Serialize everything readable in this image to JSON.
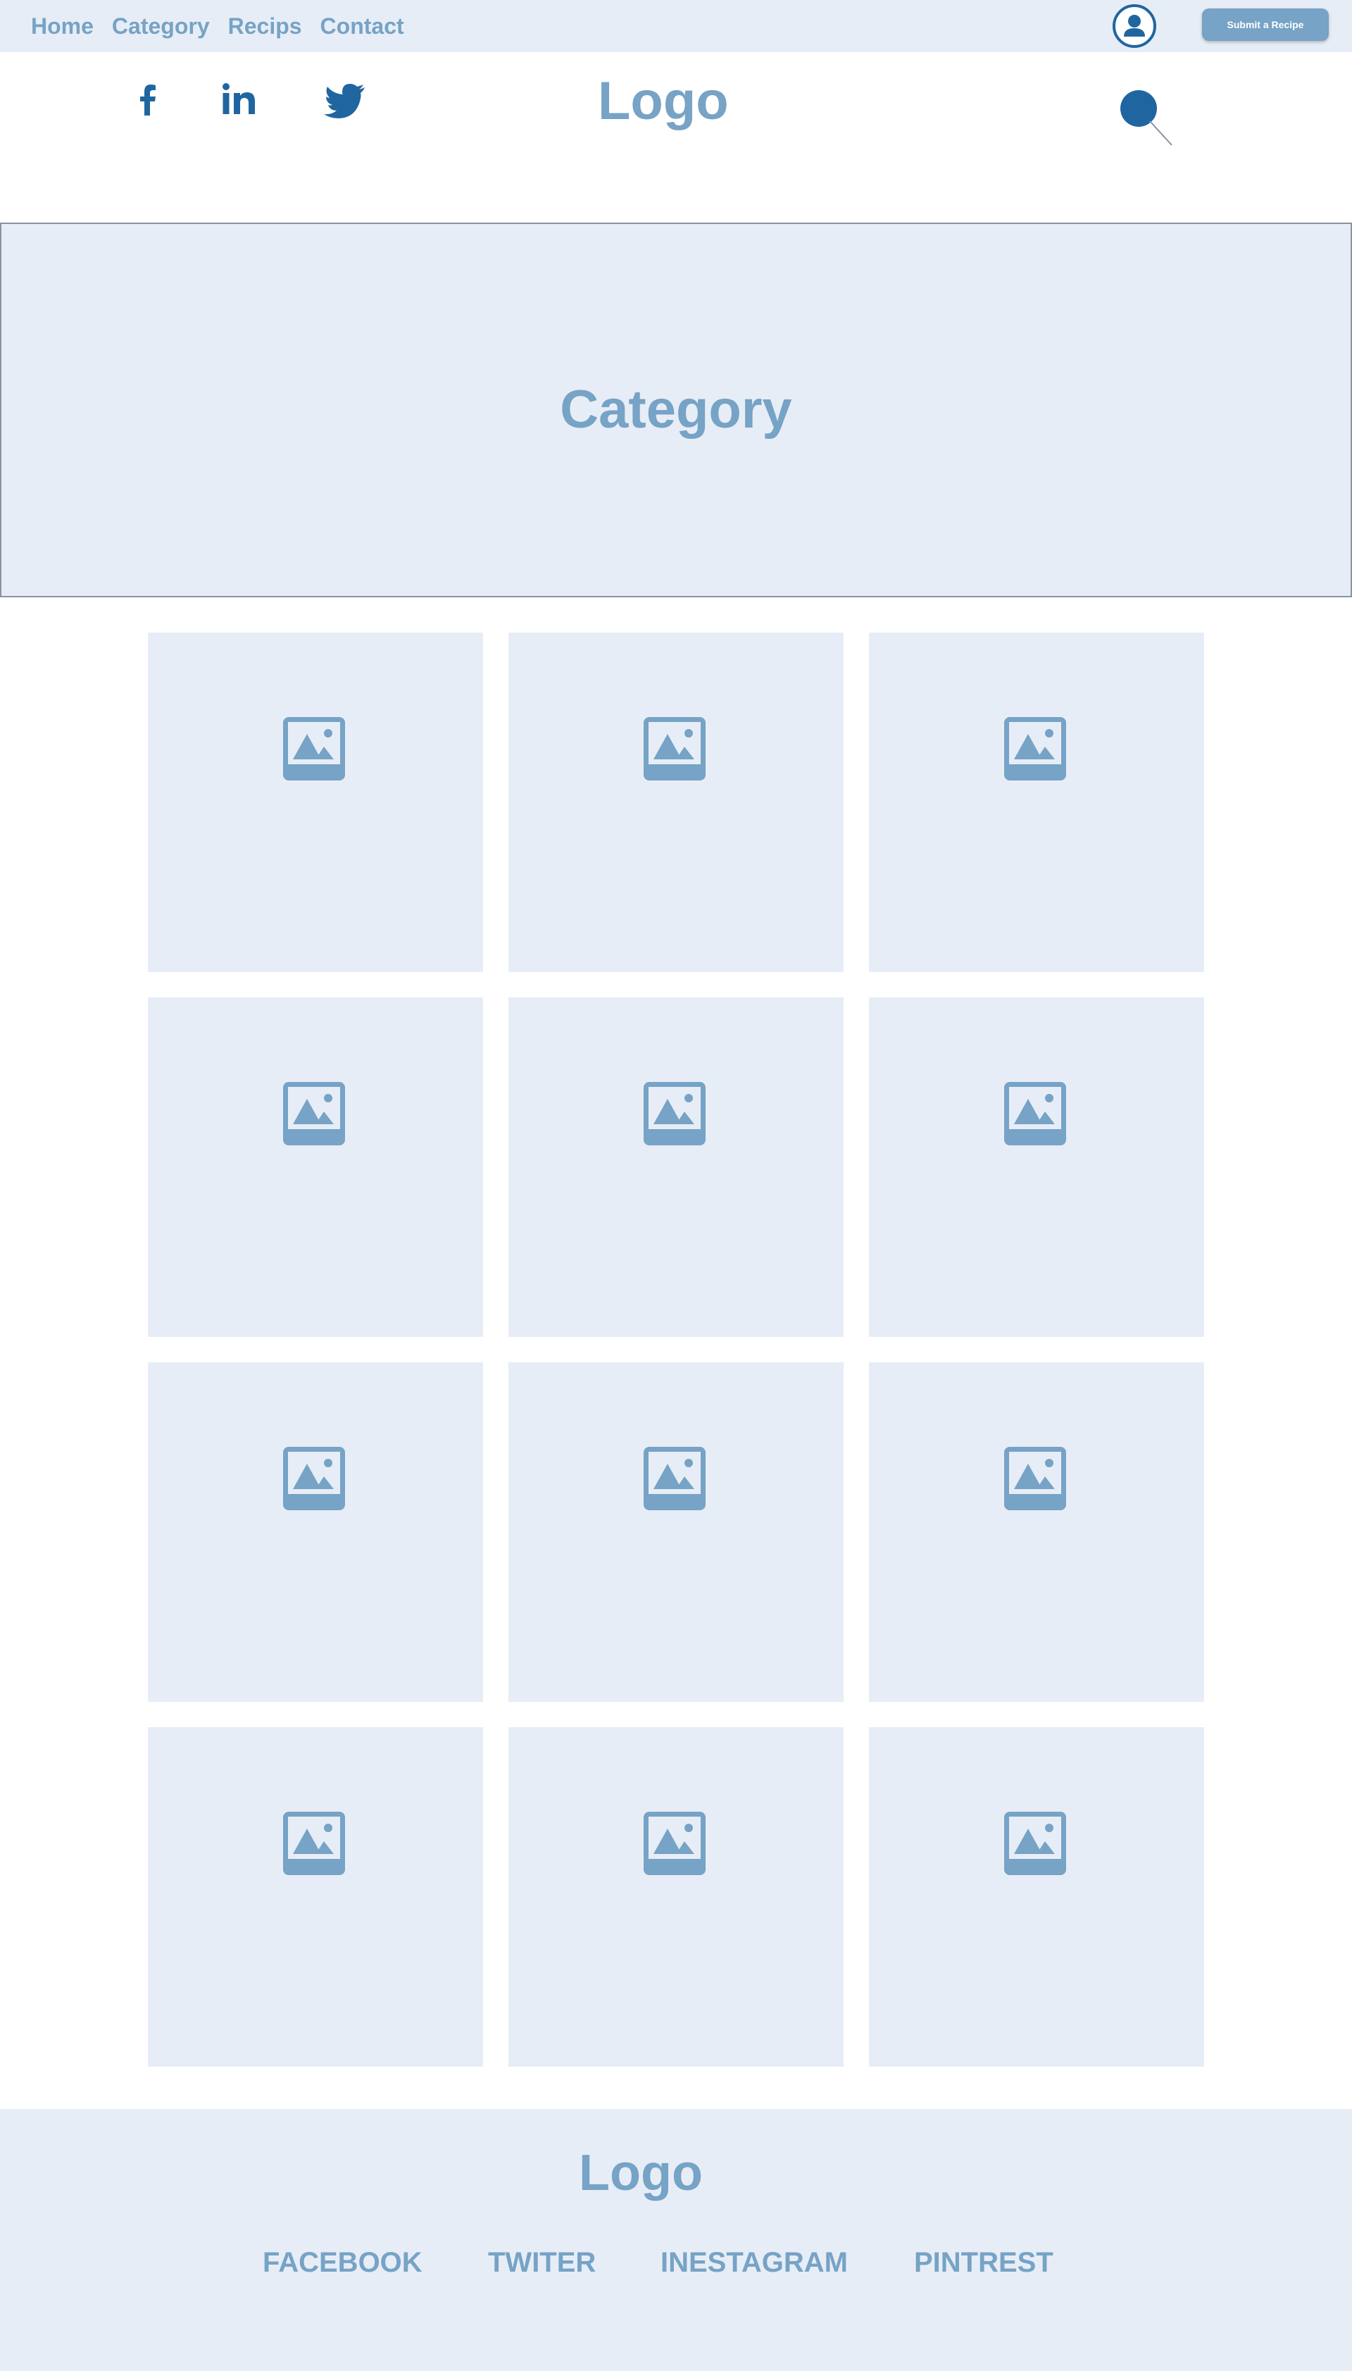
{
  "topbar": {
    "nav": [
      "Home",
      "Category",
      "Recips",
      "Contact"
    ],
    "submit_label": "Submit a Recipe"
  },
  "header": {
    "social_icons": [
      "facebook-icon",
      "linkedin-icon",
      "twitter-icon"
    ],
    "logo": "Logo"
  },
  "hero": {
    "title": "Category"
  },
  "grid": {
    "item_count": 12,
    "item_icon": "image-placeholder-icon"
  },
  "footer": {
    "logo": "Logo",
    "links": [
      "FACEBOOK",
      "TWITER",
      "INESTAGRAM",
      "PINTREST"
    ]
  },
  "colors": {
    "accent": "#76a3c6",
    "icon_dark": "#1f66a0",
    "panel_bg": "#e7edf6",
    "button_text": "#ffffff"
  }
}
